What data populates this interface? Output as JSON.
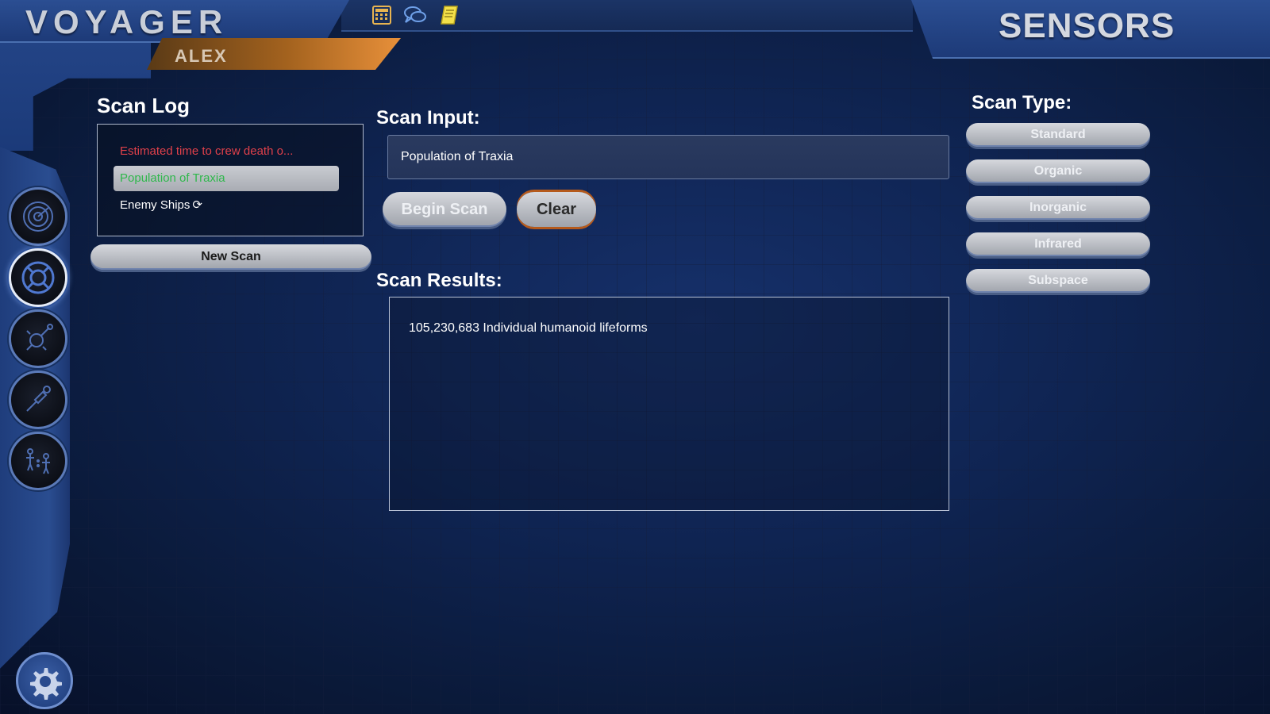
{
  "app": {
    "title": "VOYAGER",
    "user": "ALEX",
    "screen_title": "SENSORS"
  },
  "top_icons": [
    "calculator-icon",
    "chat-icon",
    "notes-icon"
  ],
  "side_nav": {
    "items": [
      {
        "icon": "radar-icon",
        "active": false
      },
      {
        "icon": "scan-target-icon",
        "active": true
      },
      {
        "icon": "probe-icon",
        "active": false
      },
      {
        "icon": "sensor-probe-icon",
        "active": false
      },
      {
        "icon": "crew-icon",
        "active": false
      }
    ],
    "settings_icon": "gear-icon"
  },
  "scan_log": {
    "title": "Scan Log",
    "items": [
      {
        "label": "Estimated time to crew death o...",
        "status": "red"
      },
      {
        "label": "Population of Traxia",
        "status": "green",
        "selected": true
      },
      {
        "label": "Enemy Ships",
        "status": "white",
        "icon": "refresh-icon"
      }
    ],
    "new_scan_label": "New Scan"
  },
  "scan_input": {
    "label": "Scan Input:",
    "value": "Population of Traxia",
    "begin_label": "Begin Scan",
    "clear_label": "Clear"
  },
  "scan_results": {
    "label": "Scan Results:",
    "text": "105,230,683 Individual humanoid lifeforms"
  },
  "scan_type": {
    "label": "Scan Type:",
    "options": [
      "Standard",
      "Organic",
      "Inorganic",
      "Infrared",
      "Subspace"
    ]
  },
  "colors": {
    "accent_orange": "#e8903a",
    "frame_blue": "#2b4e92",
    "log_red": "#e0404a",
    "log_green": "#2fb84c"
  }
}
